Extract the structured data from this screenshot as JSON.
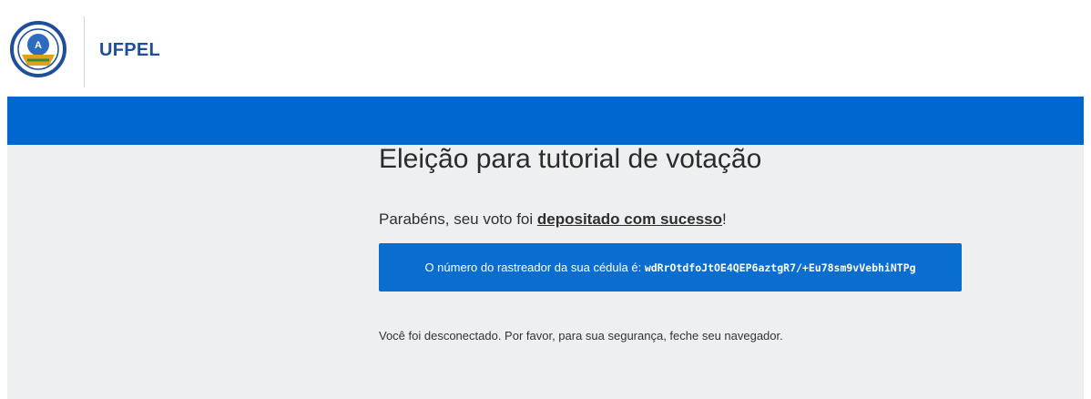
{
  "header": {
    "brand": "UFPEL"
  },
  "main": {
    "title": "Eleição para tutorial de votação",
    "success_prefix": "Parabéns, seu voto foi ",
    "success_link": "depositado com sucesso",
    "success_suffix": "!",
    "tracker_label": "O número do rastreador da sua cédula é: ",
    "tracker_code": "wdRrOtdfoJtOE4QEP6aztgR7/+Eu78sm9vVebhiNTPg",
    "logout_message": "Você foi desconectado. Por favor, para sua segurança, feche seu navegador."
  },
  "colors": {
    "bar": "#0066d0",
    "tracker_bg": "#0a6ed1",
    "brand": "#1e4f9c",
    "content_bg": "#eeeff0"
  },
  "icons": {
    "logo": "university-seal-logo"
  }
}
